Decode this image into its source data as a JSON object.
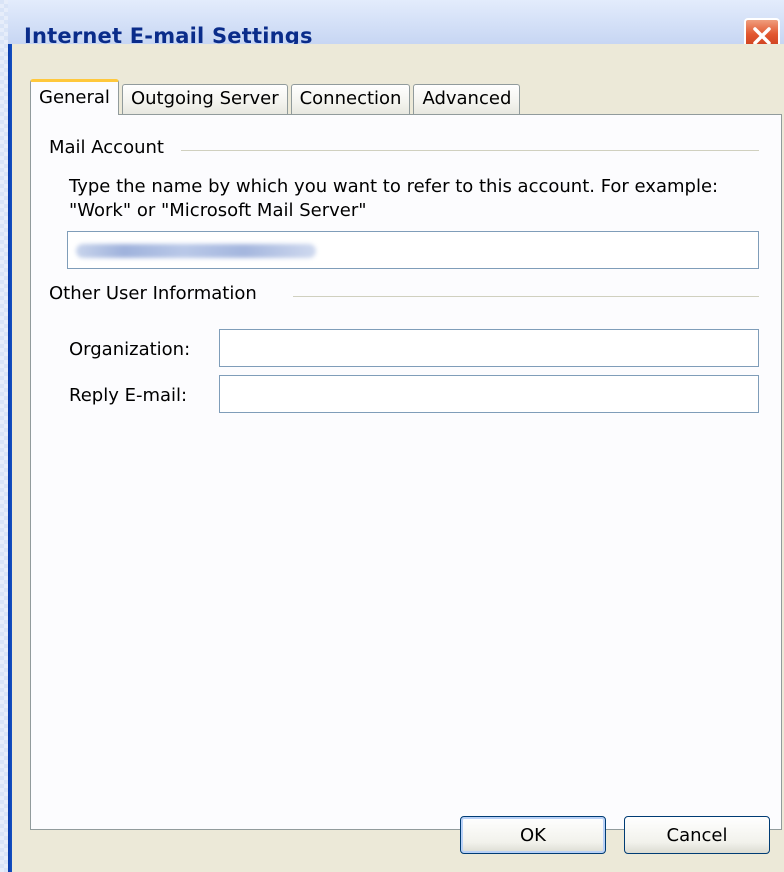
{
  "window": {
    "title": "Internet E-mail Settings"
  },
  "tabs": [
    {
      "label": "General",
      "active": true
    },
    {
      "label": "Outgoing Server",
      "active": false
    },
    {
      "label": "Connection",
      "active": false
    },
    {
      "label": "Advanced",
      "active": false
    }
  ],
  "mail_account": {
    "heading": "Mail Account",
    "description": "Type the name by which you want to refer to this account. For example: \"Work\" or \"Microsoft Mail Server\"",
    "account_name_value": ""
  },
  "other_info": {
    "heading": "Other User Information",
    "organization_label": "Organization:",
    "organization_value": "",
    "reply_label": "Reply E-mail:",
    "reply_value": ""
  },
  "buttons": {
    "ok": "OK",
    "cancel": "Cancel"
  },
  "icons": {
    "close": "close-icon"
  },
  "colors": {
    "title_text": "#0a2c8a",
    "tab_highlight": "#ffc83c",
    "close_button": "#e2572f"
  }
}
